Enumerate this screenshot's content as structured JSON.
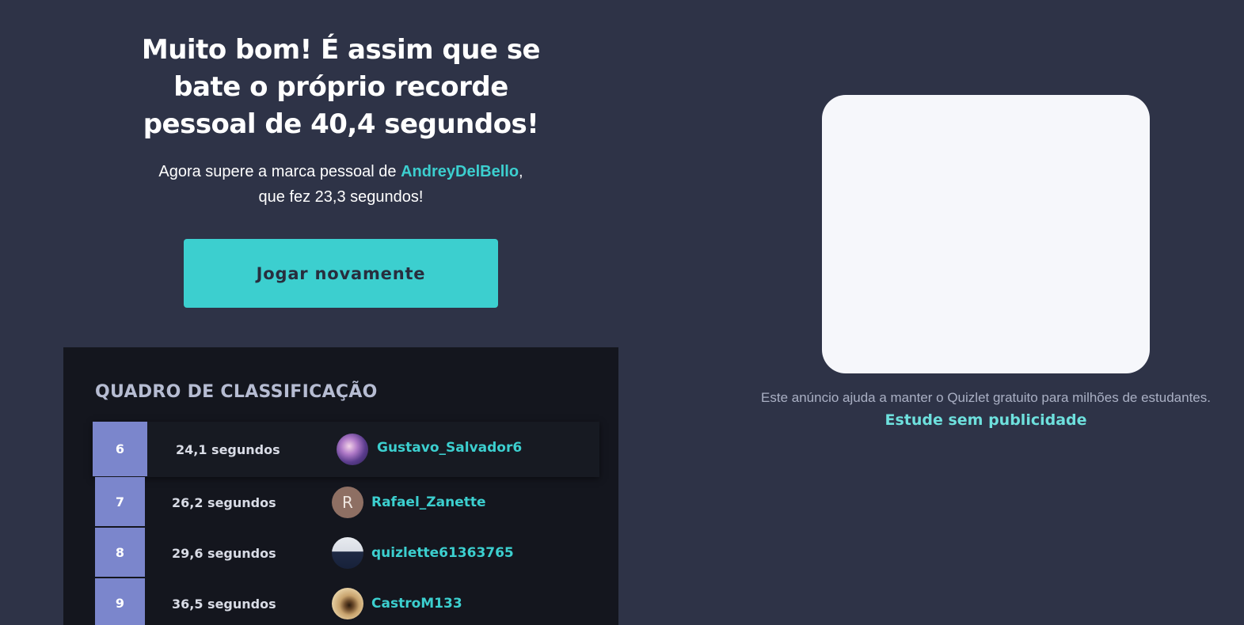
{
  "result": {
    "headline_lines": [
      "Muito bom! É assim que se",
      "bate o próprio recorde",
      "pessoal de 40,4 segundos!"
    ],
    "challenge_prefix": "Agora supere a marca pessoal de ",
    "challenge_user": "AndreyDelBello",
    "challenge_comma": ",",
    "challenge_line2": "que fez 23,3 segundos!",
    "play_again_label": "Jogar novamente"
  },
  "leaderboard": {
    "title": "QUADRO DE CLASSIFICAÇÃO",
    "rows": [
      {
        "rank": "6",
        "time": "24,1 segundos",
        "user": "Gustavo_Salvador6",
        "avatar": "galaxy-avatar"
      },
      {
        "rank": "7",
        "time": "26,2 segundos",
        "user": "Rafael_Zanette",
        "avatar": "letter-avatar",
        "avatar_letter": "R"
      },
      {
        "rank": "8",
        "time": "29,6 segundos",
        "user": "quizlette61363765",
        "avatar": "photo-avatar"
      },
      {
        "rank": "9",
        "time": "36,5 segundos",
        "user": "CastroM133",
        "avatar": "eye-avatar"
      }
    ]
  },
  "ad": {
    "note": "Este anúncio ajuda a manter o Quizlet gratuito para milhões de estudantes.",
    "ad_free_link": "Estude sem publicidade"
  },
  "colors": {
    "background": "#2e3347",
    "accent": "#3ccfcf",
    "rank_badge": "#7b86cc",
    "board_bg": "#14161e"
  }
}
